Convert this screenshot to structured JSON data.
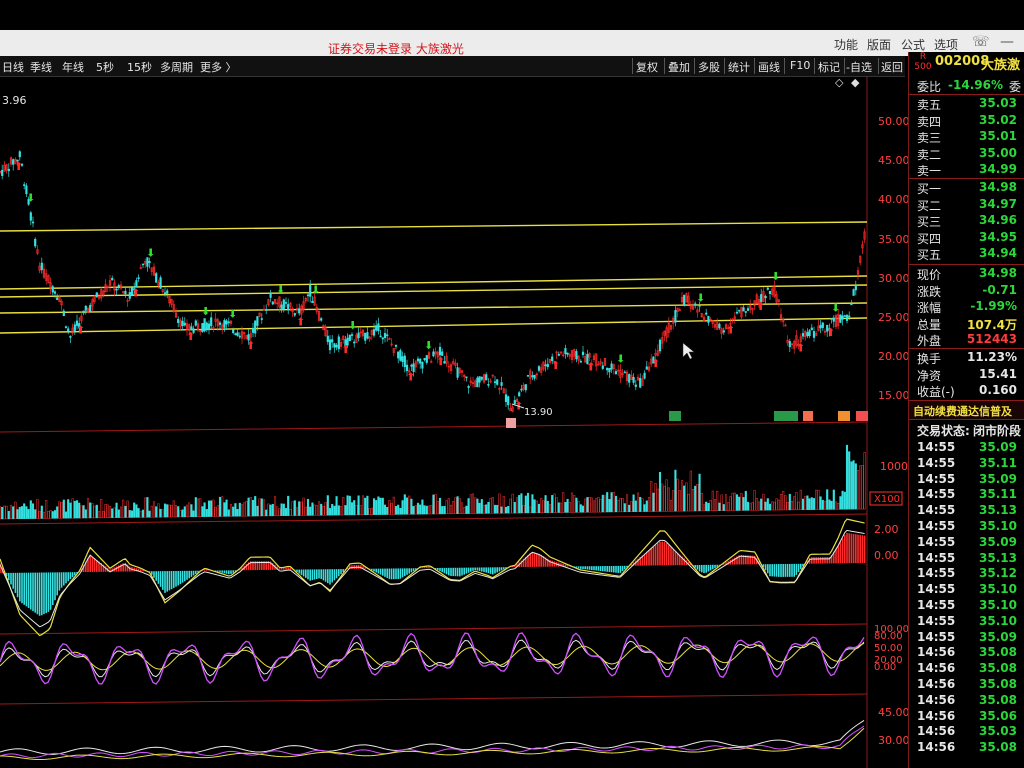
{
  "title": {
    "login_status": "证券交易未登录  大族激光"
  },
  "menu": [
    "功能",
    "版面",
    "公式",
    "选项"
  ],
  "periods": [
    "日线",
    "季线",
    "年线",
    "5秒",
    "15秒",
    "多周期",
    "更多 〉"
  ],
  "tools": [
    "复权",
    "叠加",
    "多股",
    "统计",
    "画线",
    "F10",
    "标记",
    "-自选",
    "返回"
  ],
  "chart": {
    "top_left_value": "3.96",
    "low_marker": "13.90",
    "y_ticks": [
      "50.00",
      "45.00",
      "40.00",
      "35.00",
      "30.00",
      "25.00",
      "20.00",
      "15.00"
    ],
    "vol_tick": "10000",
    "vol_unit": "X100",
    "macd_ticks": [
      "2.00",
      "0.00"
    ],
    "kdj_ticks": [
      "100.00",
      "80.00",
      "50.00",
      "20.00",
      "0.00"
    ],
    "rsi_ticks": [
      "45.00",
      "30.00"
    ],
    "colors": {
      "up": "#ff2a2a",
      "down": "#35e0e0",
      "ma_yellow": "#e8e040",
      "kdj_purple": "#d050ff",
      "volume_red": "#ff3333"
    }
  },
  "stock": {
    "code": "002008",
    "name": "大族激",
    "badge_r": "R",
    "badge_500": "500"
  },
  "quote": {
    "weibi_label": "委比",
    "weibi": "-14.96%",
    "weibi_extra": "委",
    "asks": [
      {
        "label": "卖五",
        "price": "35.03"
      },
      {
        "label": "卖四",
        "price": "35.02"
      },
      {
        "label": "卖三",
        "price": "35.01"
      },
      {
        "label": "卖二",
        "price": "35.00"
      },
      {
        "label": "卖一",
        "price": "34.99"
      }
    ],
    "bids": [
      {
        "label": "买一",
        "price": "34.98"
      },
      {
        "label": "买二",
        "price": "34.97"
      },
      {
        "label": "买三",
        "price": "34.96"
      },
      {
        "label": "买四",
        "price": "34.95"
      },
      {
        "label": "买五",
        "price": "34.94"
      }
    ],
    "stats": [
      {
        "label": "现价",
        "value": "34.98",
        "color": "#2bd63a"
      },
      {
        "label": "涨跌",
        "value": "-0.71",
        "color": "#2bd63a"
      },
      {
        "label": "涨幅",
        "value": "-1.99%",
        "color": "#2bd63a"
      },
      {
        "label": "总量",
        "value": "107.4万",
        "color": "#f0e040"
      },
      {
        "label": "外盘",
        "value": "512443",
        "color": "#ff3b3b"
      }
    ],
    "stats2": [
      {
        "label": "换手",
        "value": "11.23%",
        "color": "#e6e6e6"
      },
      {
        "label": "净资",
        "value": "15.41",
        "color": "#e6e6e6"
      },
      {
        "label": "收益(-)",
        "value": "0.160",
        "color": "#e6e6e6"
      }
    ],
    "banner": "自动续费通达信普及",
    "trade_status_label": "交易状态:",
    "trade_status": "闭市阶段"
  },
  "trades": [
    {
      "time": "14:55",
      "price": "35.09"
    },
    {
      "time": "14:55",
      "price": "35.11"
    },
    {
      "time": "14:55",
      "price": "35.09"
    },
    {
      "time": "14:55",
      "price": "35.11"
    },
    {
      "time": "14:55",
      "price": "35.13"
    },
    {
      "time": "14:55",
      "price": "35.10"
    },
    {
      "time": "14:55",
      "price": "35.09"
    },
    {
      "time": "14:55",
      "price": "35.13"
    },
    {
      "time": "14:55",
      "price": "35.12"
    },
    {
      "time": "14:55",
      "price": "35.10"
    },
    {
      "time": "14:55",
      "price": "35.10"
    },
    {
      "time": "14:55",
      "price": "35.10"
    },
    {
      "time": "14:55",
      "price": "35.09"
    },
    {
      "time": "14:56",
      "price": "35.08"
    },
    {
      "time": "14:56",
      "price": "35.08"
    },
    {
      "time": "14:56",
      "price": "35.08"
    },
    {
      "time": "14:56",
      "price": "35.08"
    },
    {
      "time": "14:56",
      "price": "35.06"
    },
    {
      "time": "14:56",
      "price": "35.03"
    },
    {
      "time": "14:56",
      "price": "35.08"
    }
  ]
}
